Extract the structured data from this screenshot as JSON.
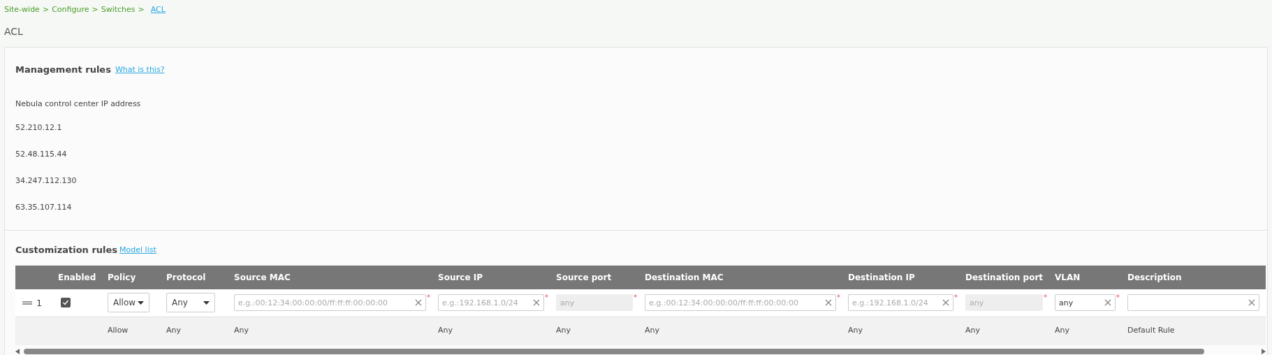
{
  "breadcrumb": [
    {
      "label": "Site-wide",
      "link": false
    },
    {
      "label": "Configure",
      "link": false
    },
    {
      "label": "Switches",
      "link": false
    },
    {
      "label": "ACL",
      "link": true
    }
  ],
  "separator": ">",
  "title": "ACL",
  "management": {
    "heading": "Management rules",
    "help_link": "What is this?",
    "label": "Nebula control center IP address",
    "addresses": [
      "52.210.12.1",
      "52.48.115.44",
      "34.247.112.130",
      "63.35.107.114"
    ]
  },
  "customization": {
    "heading": "Customization rules",
    "link": "Model list",
    "required_mark": "*",
    "table": {
      "columns": [
        "",
        "",
        "Enabled",
        "Policy",
        "Protocol",
        "Source MAC",
        "Source IP",
        "Source port",
        "Destination MAC",
        "Destination IP",
        "Destination port",
        "VLAN",
        "Description"
      ],
      "rows": [
        {
          "kind": "editable",
          "cells": [
            {
              "kind": "handle"
            },
            {
              "kind": "number",
              "value": "1"
            },
            {
              "kind": "checkbox",
              "checked": true
            },
            {
              "kind": "select",
              "value": "Allow"
            },
            {
              "kind": "select",
              "value": "Any"
            },
            {
              "kind": "input",
              "placeholder": "e.g.:00:12:34:00:00:00/ff:ff:ff:00:00:00",
              "disabled": false,
              "required": true
            },
            {
              "kind": "input",
              "placeholder": "e.g.:192.168.1.0/24",
              "disabled": false,
              "required": true
            },
            {
              "kind": "input",
              "placeholder": "any",
              "disabled": true,
              "required": true
            },
            {
              "kind": "input",
              "placeholder": "e.g.:00:12:34:00:00:00/ff:ff:ff:00:00:00",
              "disabled": false,
              "required": true
            },
            {
              "kind": "input",
              "placeholder": "e.g.:192.168.1.0/24",
              "disabled": false,
              "required": true
            },
            {
              "kind": "input",
              "placeholder": "any",
              "disabled": true,
              "required": true
            },
            {
              "kind": "input",
              "value": "any",
              "disabled": false,
              "required": true
            },
            {
              "kind": "input",
              "disabled": false,
              "required": false
            }
          ]
        },
        {
          "kind": "default",
          "cells": [
            "",
            "",
            "",
            "Allow",
            "Any",
            "Any",
            "Any",
            "Any",
            "Any",
            "Any",
            "Any",
            "Any",
            "Default Rule"
          ]
        }
      ]
    }
  }
}
